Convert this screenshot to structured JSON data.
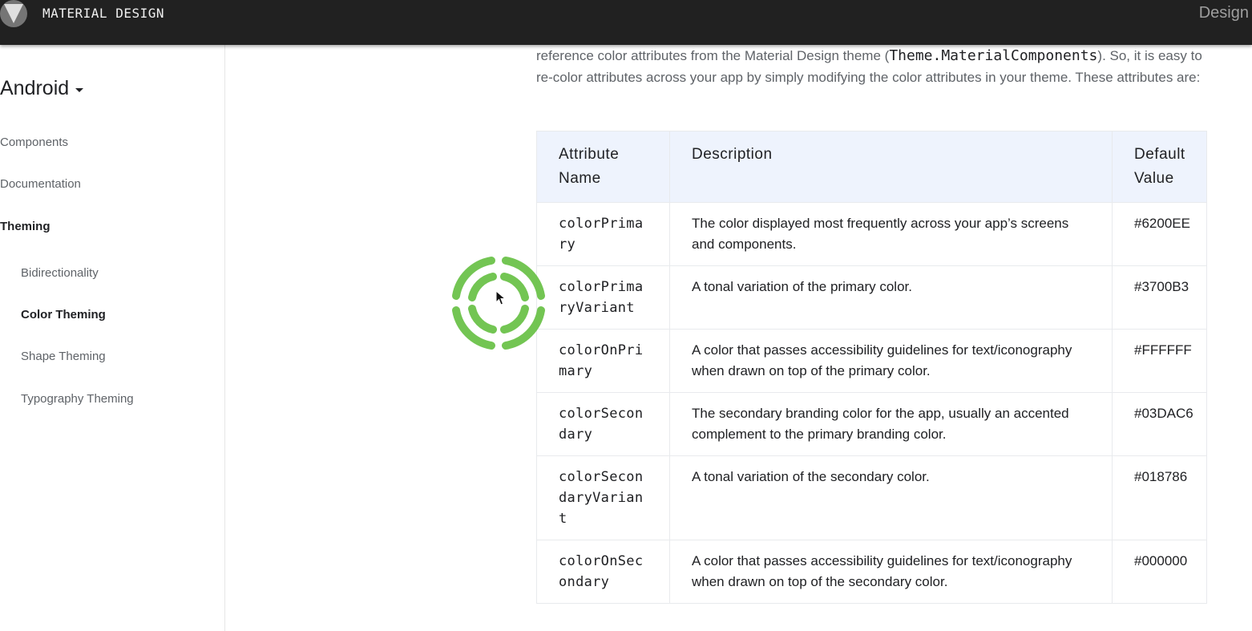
{
  "header": {
    "brand": "MATERIAL DESIGN",
    "right_label": "Design",
    "logo_icon": "material-logo-icon"
  },
  "sidebar": {
    "platform": "Android",
    "items": [
      {
        "label": "Components",
        "active": false
      },
      {
        "label": "Documentation",
        "active": false
      },
      {
        "label": "Theming",
        "active": true
      }
    ],
    "subitems": [
      {
        "label": "Bidirectionality",
        "active": false
      },
      {
        "label": "Color Theming",
        "active": true
      },
      {
        "label": "Shape Theming",
        "active": false
      },
      {
        "label": "Typography Theming",
        "active": false
      }
    ]
  },
  "content": {
    "intro_before": "reference color attributes from the Material Design theme (",
    "intro_code": "Theme.MaterialComponents",
    "intro_after": "). So, it is easy to re-color attributes across your app by simply modifying the color attributes in your theme. These attributes are:",
    "table": {
      "headers": [
        "Attribute Name",
        "Description",
        "Default Value"
      ],
      "rows": [
        {
          "name": "colorPrimary",
          "description": "The color displayed most frequently across your app’s screens and components.",
          "default": "#6200EE"
        },
        {
          "name": "colorPrimaryVariant",
          "description": "A tonal variation of the primary color.",
          "default": "#3700B3"
        },
        {
          "name": "colorOnPrimary",
          "description": "A color that passes accessibility guidelines for text/iconography when drawn on top of the primary color.",
          "default": "#FFFFFF"
        },
        {
          "name": "colorSecondary",
          "description": "The secondary branding color for the app, usually an accented complement to the primary branding color.",
          "default": "#03DAC6"
        },
        {
          "name": "colorSecondaryVariant",
          "description": "A tonal variation of the secondary color.",
          "default": "#018786"
        },
        {
          "name": "colorOnSecondary",
          "description": "A color that passes accessibility guidelines for text/iconography when drawn on top of the secondary color.",
          "default": "#000000"
        }
      ]
    }
  },
  "overlay": {
    "spinner_icon": "loading-spinner-icon",
    "spinner_color": "#6cc24a",
    "cursor_icon": "mouse-pointer-icon"
  },
  "colors": {
    "topbar": "#212121",
    "table_header_bg": "#eef3fd"
  }
}
